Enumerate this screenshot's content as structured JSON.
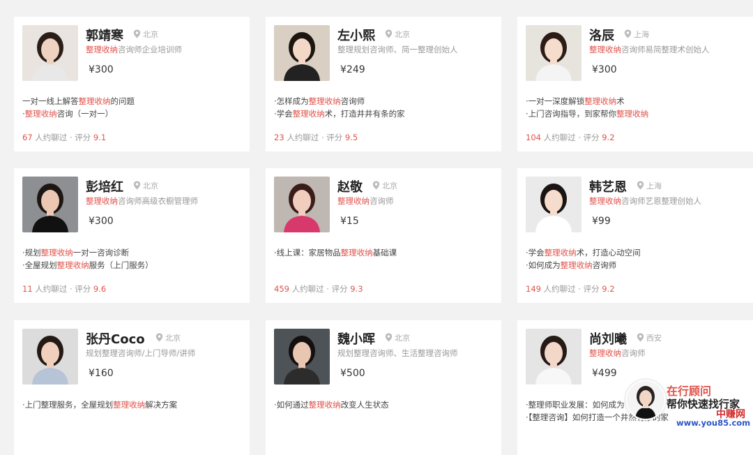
{
  "cards": [
    {
      "name": "郭靖寒",
      "location": "北京",
      "title_hl": "整理收纳",
      "title_rest": "咨询师企业培训师",
      "price": "¥300",
      "bullets": [
        {
          "pre": "一对一线上解答",
          "hl": "整理收纳",
          "post": "的问题"
        },
        {
          "pre": "·",
          "hl": "整理收纳",
          "post": "咨询（一对一）"
        }
      ],
      "chats": "67",
      "chat_label": "人约聊过",
      "score_label": "评分",
      "score": "9.1"
    },
    {
      "name": "左小熙",
      "location": "北京",
      "title_hl": "",
      "title_rest": "整理规划咨询师、简一整理创始人",
      "price": "¥249",
      "bullets": [
        {
          "pre": "·怎样成为",
          "hl": "整理收纳",
          "post": "咨询师"
        },
        {
          "pre": "·学会",
          "hl": "整理收纳",
          "post": "术，打造井井有条的家"
        }
      ],
      "chats": "23",
      "chat_label": "人约聊过",
      "score_label": "评分",
      "score": "9.5"
    },
    {
      "name": "洛辰",
      "location": "上海",
      "title_hl": "整理收纳",
      "title_rest": "咨询师易简整理术创始人",
      "price": "¥300",
      "bullets": [
        {
          "pre": "·一对一深度解锁",
          "hl": "整理收纳",
          "post": "术"
        },
        {
          "pre": "·上门咨询指导，到家帮你",
          "hl": "整理收纳",
          "post": ""
        }
      ],
      "chats": "104",
      "chat_label": "人约聊过",
      "score_label": "评分",
      "score": "9.2"
    },
    {
      "name": "彭培红",
      "location": "北京",
      "title_hl": "整理收纳",
      "title_rest": "咨询师高级衣橱管理师",
      "price": "¥300",
      "bullets": [
        {
          "pre": "·规划",
          "hl": "整理收纳",
          "post": "一对一咨询诊断"
        },
        {
          "pre": "·全屋规划",
          "hl": "整理收纳",
          "post": "服务（上门服务）"
        }
      ],
      "chats": "11",
      "chat_label": "人约聊过",
      "score_label": "评分",
      "score": "9.6"
    },
    {
      "name": "赵敬",
      "location": "北京",
      "title_hl": "整理收纳",
      "title_rest": "咨询师",
      "price": "¥15",
      "bullets": [
        {
          "pre": "·线上课：家居物品",
          "hl": "整理收纳",
          "post": "基础课"
        }
      ],
      "chats": "459",
      "chat_label": "人约聊过",
      "score_label": "评分",
      "score": "9.3"
    },
    {
      "name": "韩艺恩",
      "location": "上海",
      "title_hl": "整理收纳",
      "title_rest": "咨询师艺恩整理创始人",
      "price": "¥99",
      "bullets": [
        {
          "pre": "·学会",
          "hl": "整理收纳",
          "post": "术，打造心动空间"
        },
        {
          "pre": "·如何成为",
          "hl": "整理收纳",
          "post": "咨询师"
        }
      ],
      "chats": "149",
      "chat_label": "人约聊过",
      "score_label": "评分",
      "score": "9.2"
    },
    {
      "name": "张丹Coco",
      "location": "北京",
      "title_hl": "",
      "title_rest": "规划整理咨询师/上门导师/讲师",
      "price": "¥160",
      "bullets": [
        {
          "pre": "·上门整理服务，全屋规划",
          "hl": "整理收纳",
          "post": "解决方案"
        }
      ],
      "chats": "",
      "chat_label": "",
      "score_label": "",
      "score": ""
    },
    {
      "name": "魏小晖",
      "location": "北京",
      "title_hl": "",
      "title_rest": "规划整理咨询师、生活整理咨询师",
      "price": "¥500",
      "bullets": [
        {
          "pre": "·如何通过",
          "hl": "整理收纳",
          "post": "改变人生状态"
        }
      ],
      "chats": "",
      "chat_label": "",
      "score_label": "",
      "score": ""
    },
    {
      "name": "尚刘曦",
      "location": "西安",
      "title_hl": "整理收纳",
      "title_rest": "咨询师",
      "price": "¥499",
      "bullets": [
        {
          "pre": "·整理师职业发展：如何成为",
          "hl": "",
          "post": ""
        },
        {
          "pre": "·【整理咨询】如何打造一个井然有序的家",
          "hl": "",
          "post": ""
        }
      ],
      "chats": "",
      "chat_label": "",
      "score_label": "",
      "score": ""
    }
  ],
  "advisor": {
    "line1": "在行顾问",
    "line2": "帮你快速找行家",
    "watermark_cn": "中赚网",
    "watermark_url": "www.you85.com"
  },
  "colors": {
    "accent": "#e0524a",
    "background": "#f2f2f2",
    "card": "#ffffff",
    "muted": "#999999",
    "watermark_url": "#2a55c8"
  },
  "icons": {
    "location": "location-pin-icon"
  }
}
